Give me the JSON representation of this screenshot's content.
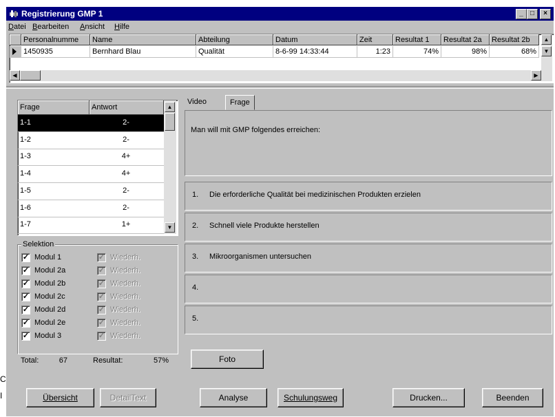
{
  "window": {
    "title": "Registrierung GMP 1"
  },
  "menu": [
    {
      "pre": "",
      "accel": "D",
      "post": "atei"
    },
    {
      "pre": "",
      "accel": "B",
      "post": "earbeiten"
    },
    {
      "pre": "",
      "accel": "A",
      "post": "nsicht"
    },
    {
      "pre": "",
      "accel": "H",
      "post": "ilfe"
    }
  ],
  "grid": {
    "headers": [
      "Personalnumme",
      "Name",
      "Abteilung",
      "Datum",
      "Zeit",
      "Resultat 1",
      "Resultat 2a",
      "Resultat 2b"
    ],
    "row": [
      "1450935",
      "Bernhard Blau",
      "Qualität",
      "8-6-99 14:33:44",
      "1:23",
      "74%",
      "98%",
      "68%"
    ]
  },
  "questions": {
    "headers": [
      "Frage",
      "Antwort"
    ],
    "rows": [
      {
        "frage": "1-1",
        "antwort": "2-"
      },
      {
        "frage": "1-2",
        "antwort": "2-"
      },
      {
        "frage": "1-3",
        "antwort": "4+"
      },
      {
        "frage": "1-4",
        "antwort": "4+"
      },
      {
        "frage": "1-5",
        "antwort": "2-"
      },
      {
        "frage": "1-6",
        "antwort": "2-"
      },
      {
        "frage": "1-7",
        "antwort": "1+"
      }
    ],
    "selected_index": 0
  },
  "selektion": {
    "label": "Selektion",
    "modules": [
      "Modul 1",
      "Modul 2a",
      "Modul 2b",
      "Modul 2c",
      "Modul 2d",
      "Modul 2e",
      "Modul 3"
    ],
    "repeat_label": "Wiederh.",
    "total_label": "Total:",
    "total_value": "67",
    "result_label": "Resultat:",
    "result_value": "57%"
  },
  "tabs": [
    "Video",
    "Frage"
  ],
  "question_text": "Man will mit GMP folgendes erreichen:",
  "answers": [
    {
      "num": "1.",
      "text": "Die erforderliche Qualität bei medizinischen Produkten erzielen"
    },
    {
      "num": "2.",
      "text": "Schnell viele Produkte herstellen"
    },
    {
      "num": "3.",
      "text": "Mikroorganismen untersuchen"
    },
    {
      "num": "4.",
      "text": ""
    },
    {
      "num": "5.",
      "text": ""
    }
  ],
  "buttons": {
    "foto": "Foto",
    "uebersicht": "Übersicht",
    "detailtext": "DetailText",
    "analyse": "Analyse",
    "schulungsweg": "Schulungsweg",
    "drucken": "Drucken...",
    "beenden": "Beenden"
  },
  "outside_fragments": [
    "C",
    "I"
  ]
}
